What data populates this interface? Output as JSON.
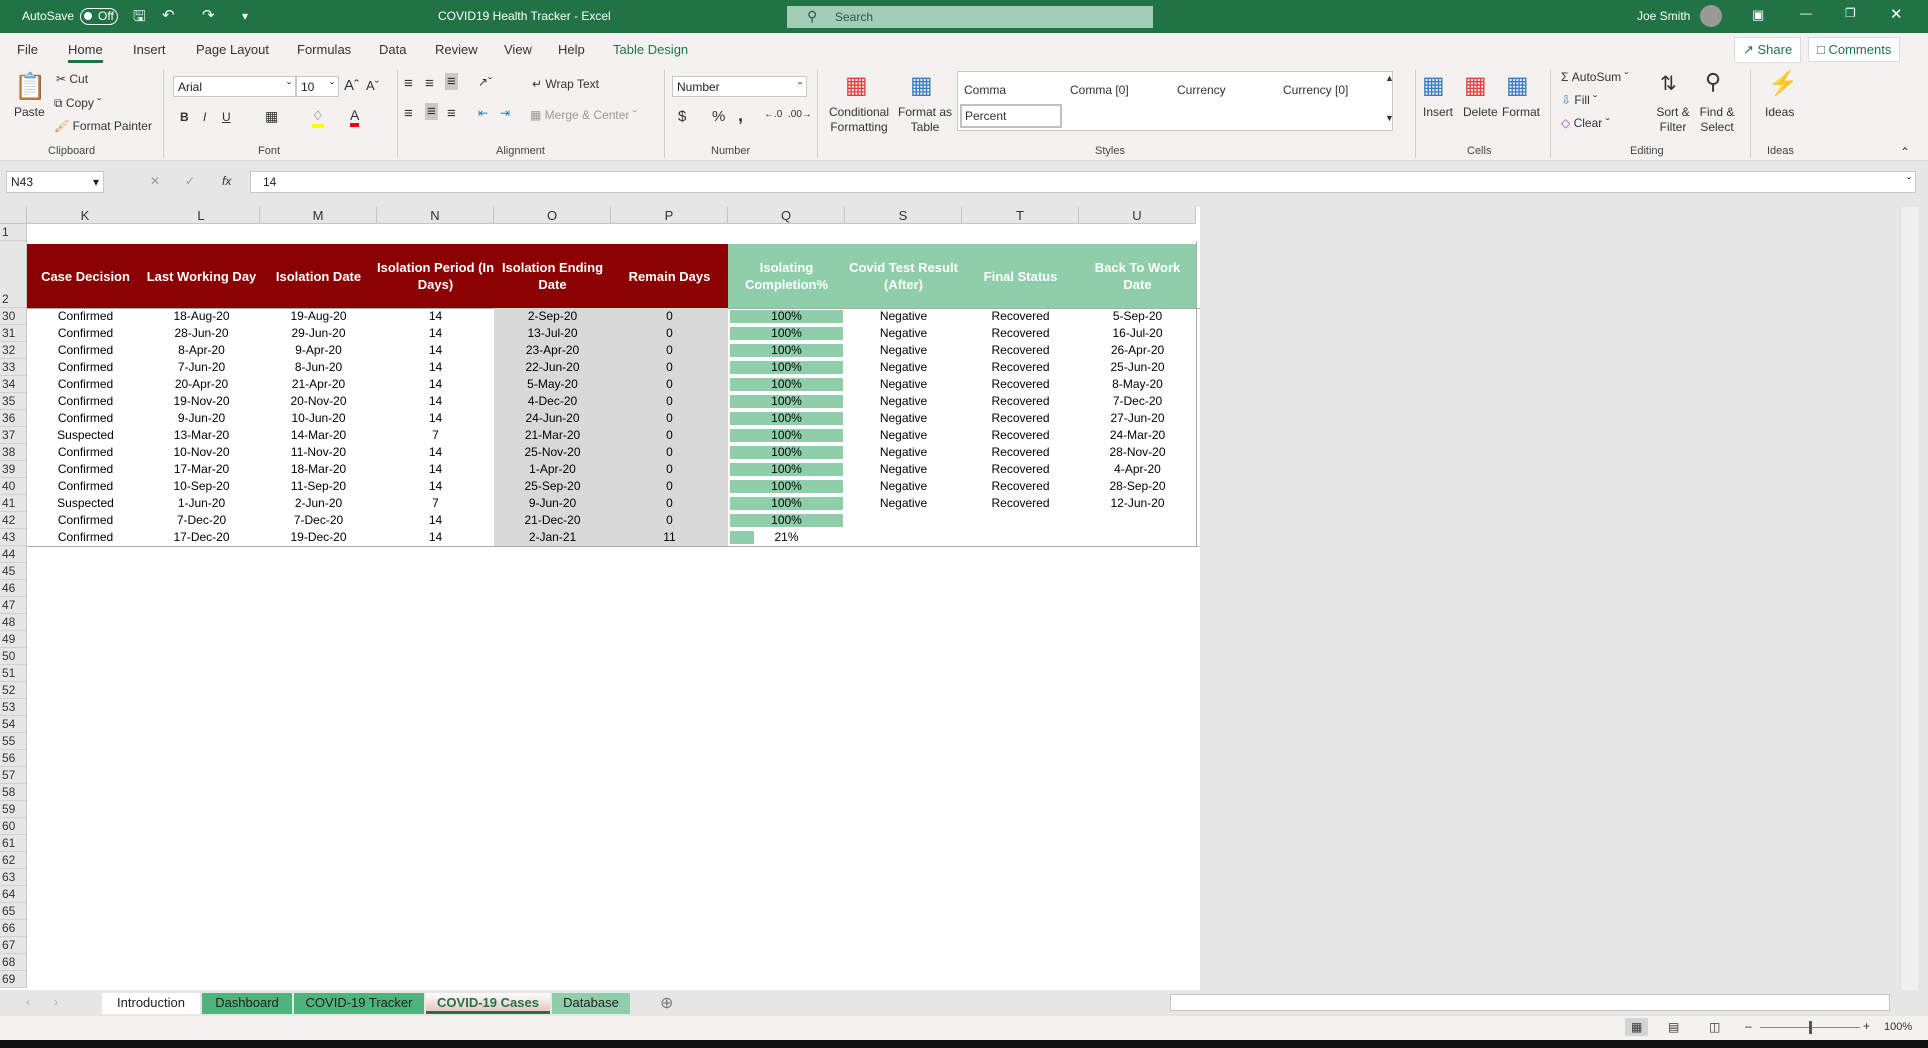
{
  "title_bar": {
    "autosave_label": "AutoSave",
    "autosave_state": "Off",
    "doc_title": "COVID19 Health Tracker  -  Excel",
    "search_placeholder": "Search",
    "user": "Joe Smith"
  },
  "ribbon_tabs": [
    "File",
    "Home",
    "Insert",
    "Page Layout",
    "Formulas",
    "Data",
    "Review",
    "View",
    "Help",
    "Table Design"
  ],
  "ribbon": {
    "clipboard": {
      "paste": "Paste",
      "cut": "Cut",
      "copy": "Copy",
      "format_painter": "Format Painter",
      "label": "Clipboard"
    },
    "font": {
      "name": "Arial",
      "size": "10",
      "bold": "B",
      "italic": "I",
      "underline": "U",
      "label": "Font",
      "fill_color": "#ffff00",
      "font_color": "#ff0000"
    },
    "alignment": {
      "wrap": "Wrap Text",
      "merge": "Merge & Center",
      "label": "Alignment"
    },
    "number": {
      "format": "Number",
      "currency": "$",
      "percent": "%",
      "comma": ",",
      "label": "Number"
    },
    "styles": {
      "conditional": "Conditional Formatting",
      "format_table": "Format as Table",
      "gallery": [
        "Comma",
        "Comma [0]",
        "Currency",
        "Currency [0]",
        "Percent"
      ],
      "label": "Styles"
    },
    "cells": {
      "insert": "Insert",
      "delete": "Delete",
      "format": "Format",
      "label": "Cells"
    },
    "editing": {
      "autosum": "AutoSum",
      "fill": "Fill",
      "clear": "Clear",
      "sort": "Sort & Filter",
      "find": "Find & Select",
      "label": "Editing"
    },
    "ideas": {
      "ideas": "Ideas",
      "label": "Ideas"
    },
    "share": "Share",
    "comments": "Comments"
  },
  "formula_bar": {
    "name_box": "N43",
    "fx": "fx",
    "value": "14"
  },
  "columns": [
    "K",
    "L",
    "M",
    "N",
    "O",
    "P",
    "Q",
    "S",
    "T",
    "U"
  ],
  "headers": [
    "Case Decision",
    "Last Working Day",
    "Isolation Date",
    "Isolation Period (In Days)",
    "Isolation Ending Date",
    "Remain Days",
    "Isolating Completion%",
    "Covid Test Result (After)",
    "Final Status",
    "Back To Work Date"
  ],
  "colors": {
    "header_red": "#8b0000",
    "header_green": "#8fceaa",
    "bar_green": "#8fceaa",
    "excel_green": "#217346"
  },
  "rows": [
    {
      "n": "30",
      "k": "Confirmed",
      "l": "18-Aug-20",
      "m": "19-Aug-20",
      "nn": "14",
      "o": "2-Sep-20",
      "p": "0",
      "q": "100%",
      "qv": 1,
      "s": "Negative",
      "t": "Recovered",
      "u": "5-Sep-20"
    },
    {
      "n": "31",
      "k": "Confirmed",
      "l": "28-Jun-20",
      "m": "29-Jun-20",
      "nn": "14",
      "o": "13-Jul-20",
      "p": "0",
      "q": "100%",
      "qv": 1,
      "s": "Negative",
      "t": "Recovered",
      "u": "16-Jul-20"
    },
    {
      "n": "32",
      "k": "Confirmed",
      "l": "8-Apr-20",
      "m": "9-Apr-20",
      "nn": "14",
      "o": "23-Apr-20",
      "p": "0",
      "q": "100%",
      "qv": 1,
      "s": "Negative",
      "t": "Recovered",
      "u": "26-Apr-20"
    },
    {
      "n": "33",
      "k": "Confirmed",
      "l": "7-Jun-20",
      "m": "8-Jun-20",
      "nn": "14",
      "o": "22-Jun-20",
      "p": "0",
      "q": "100%",
      "qv": 1,
      "s": "Negative",
      "t": "Recovered",
      "u": "25-Jun-20"
    },
    {
      "n": "34",
      "k": "Confirmed",
      "l": "20-Apr-20",
      "m": "21-Apr-20",
      "nn": "14",
      "o": "5-May-20",
      "p": "0",
      "q": "100%",
      "qv": 1,
      "s": "Negative",
      "t": "Recovered",
      "u": "8-May-20"
    },
    {
      "n": "35",
      "k": "Confirmed",
      "l": "19-Nov-20",
      "m": "20-Nov-20",
      "nn": "14",
      "o": "4-Dec-20",
      "p": "0",
      "q": "100%",
      "qv": 1,
      "s": "Negative",
      "t": "Recovered",
      "u": "7-Dec-20"
    },
    {
      "n": "36",
      "k": "Confirmed",
      "l": "9-Jun-20",
      "m": "10-Jun-20",
      "nn": "14",
      "o": "24-Jun-20",
      "p": "0",
      "q": "100%",
      "qv": 1,
      "s": "Negative",
      "t": "Recovered",
      "u": "27-Jun-20"
    },
    {
      "n": "37",
      "k": "Suspected",
      "l": "13-Mar-20",
      "m": "14-Mar-20",
      "nn": "7",
      "o": "21-Mar-20",
      "p": "0",
      "q": "100%",
      "qv": 1,
      "s": "Negative",
      "t": "Recovered",
      "u": "24-Mar-20"
    },
    {
      "n": "38",
      "k": "Confirmed",
      "l": "10-Nov-20",
      "m": "11-Nov-20",
      "nn": "14",
      "o": "25-Nov-20",
      "p": "0",
      "q": "100%",
      "qv": 1,
      "s": "Negative",
      "t": "Recovered",
      "u": "28-Nov-20"
    },
    {
      "n": "39",
      "k": "Confirmed",
      "l": "17-Mar-20",
      "m": "18-Mar-20",
      "nn": "14",
      "o": "1-Apr-20",
      "p": "0",
      "q": "100%",
      "qv": 1,
      "s": "Negative",
      "t": "Recovered",
      "u": "4-Apr-20"
    },
    {
      "n": "40",
      "k": "Confirmed",
      "l": "10-Sep-20",
      "m": "11-Sep-20",
      "nn": "14",
      "o": "25-Sep-20",
      "p": "0",
      "q": "100%",
      "qv": 1,
      "s": "Negative",
      "t": "Recovered",
      "u": "28-Sep-20"
    },
    {
      "n": "41",
      "k": "Suspected",
      "l": "1-Jun-20",
      "m": "2-Jun-20",
      "nn": "7",
      "o": "9-Jun-20",
      "p": "0",
      "q": "100%",
      "qv": 1,
      "s": "Negative",
      "t": "Recovered",
      "u": "12-Jun-20"
    },
    {
      "n": "42",
      "k": "Confirmed",
      "l": "7-Dec-20",
      "m": "7-Dec-20",
      "nn": "14",
      "o": "21-Dec-20",
      "p": "0",
      "q": "100%",
      "qv": 1,
      "s": "",
      "t": "",
      "u": ""
    },
    {
      "n": "43",
      "k": "Confirmed",
      "l": "17-Dec-20",
      "m": "19-Dec-20",
      "nn": "14",
      "o": "2-Jan-21",
      "p": "11",
      "q": "21%",
      "qv": 0.21,
      "s": "",
      "t": "",
      "u": ""
    }
  ],
  "empty_rows_start": 44,
  "empty_rows_end": 69,
  "sheet_tabs": [
    {
      "label": "Introduction",
      "active": false,
      "color": "#ffffff"
    },
    {
      "label": "Dashboard",
      "active": false,
      "color": "#4fb37c"
    },
    {
      "label": "COVID-19 Tracker",
      "active": false,
      "color": "#4fb37c"
    },
    {
      "label": "COVID-19 Cases",
      "active": true,
      "color": "#e8c4c4"
    },
    {
      "label": "Database",
      "active": false,
      "color": "#8fceaa"
    }
  ],
  "status": {
    "zoom": "100%"
  }
}
